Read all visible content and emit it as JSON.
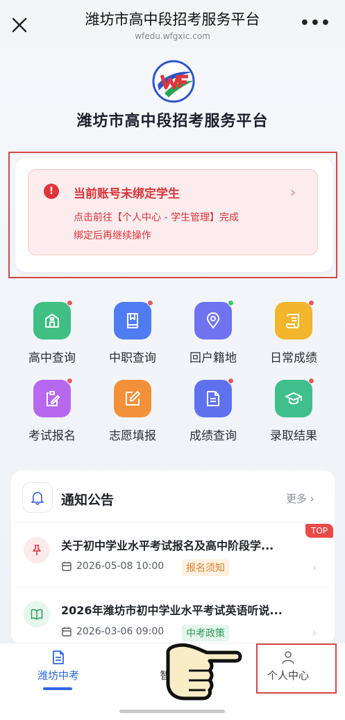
{
  "topbar": {
    "title": "潍坊市高中段招考服务平台",
    "url": "wfedu.wfgxic.com",
    "more_icon": "ellipsis-icon",
    "close_icon": "close-icon"
  },
  "brand": {
    "logo_icon": "wf-logo-icon",
    "name": "潍坊市高中段招考服务平台"
  },
  "alert": {
    "icon": "exclamation-icon",
    "title": "当前账号未绑定学生",
    "line1": "点击前往【个人中心 - 学生管理】完成",
    "line2": "绑定后再继续操作",
    "chevron": "›"
  },
  "grid": [
    {
      "label": "高中查询",
      "icon": "school-icon",
      "color": "#3fbf83",
      "dot": "red"
    },
    {
      "label": "中职查询",
      "icon": "book-icon",
      "color": "#4f7cf0",
      "dot": "red"
    },
    {
      "label": "回户籍地",
      "icon": "location-pin-icon",
      "color": "#6f73f0",
      "dot": "green"
    },
    {
      "label": "日常成绩",
      "icon": "scroll-icon",
      "color": "#f3b52c",
      "dot": "red"
    },
    {
      "label": "考试报名",
      "icon": "clipboard-edit-icon",
      "color": "#b768ef",
      "dot": "red"
    },
    {
      "label": "志愿填报",
      "icon": "edit-square-icon",
      "color": "#f3913a",
      "dot": "none"
    },
    {
      "label": "成绩查询",
      "icon": "document-icon",
      "color": "#5f72ee",
      "dot": "red"
    },
    {
      "label": "录取结果",
      "icon": "graduation-cap-icon",
      "color": "#3fbf8c",
      "dot": "red"
    }
  ],
  "notice": {
    "title": "通知公告",
    "more": "更多 ›",
    "bell_icon": "bell-icon",
    "items": [
      {
        "title": "关于初中学业水平考试报名及高中阶段学...",
        "date": "2026-05-08 10:00",
        "tag": "报名须知",
        "tag_color": "orange",
        "icon": "pin-icon",
        "badge": "TOP"
      },
      {
        "title": "2026年潍坊市初中学业水平考试英语听说...",
        "date": "2026-03-06 09:00",
        "tag": "中考政策",
        "tag_color": "green",
        "icon": "open-book-icon"
      }
    ]
  },
  "nav": {
    "home": "潍坊中考",
    "middle": "智",
    "me": "个人中心"
  }
}
